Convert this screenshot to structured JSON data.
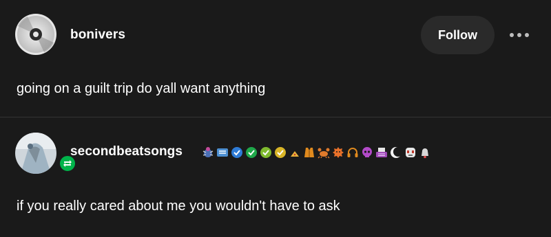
{
  "posts": [
    {
      "username": "bonivers",
      "avatar_icon": "cd-disc-icon",
      "follow_label": "Follow",
      "more_icon": "more-dots-icon",
      "text": "going on a guilt trip do yall want anything"
    },
    {
      "username": "secondbeatsongs",
      "avatar_icon": "profile-photo",
      "reblog_icon": "reblog-icon",
      "badges": [
        "bug-badge-icon",
        "ticket-badge-icon",
        "verified-blue-icon",
        "verified-green-icon",
        "verified-lime-icon",
        "verified-yellow-icon",
        "pizza-badge-icon",
        "vest-badge-icon",
        "crab-badge-icon",
        "orange-blob-icon",
        "headphones-icon",
        "skull-badge-icon",
        "typewriter-badge-icon",
        "moon-badge-icon",
        "mask-badge-icon",
        "bell-badge-icon"
      ],
      "text": "if you really cared about me you wouldn't have to ask"
    }
  ],
  "colors": {
    "background": "#1a1a1a",
    "text": "#ffffff",
    "button_bg": "#2a2a2a",
    "reblog_green": "#00b34a",
    "divider": "#333333"
  }
}
